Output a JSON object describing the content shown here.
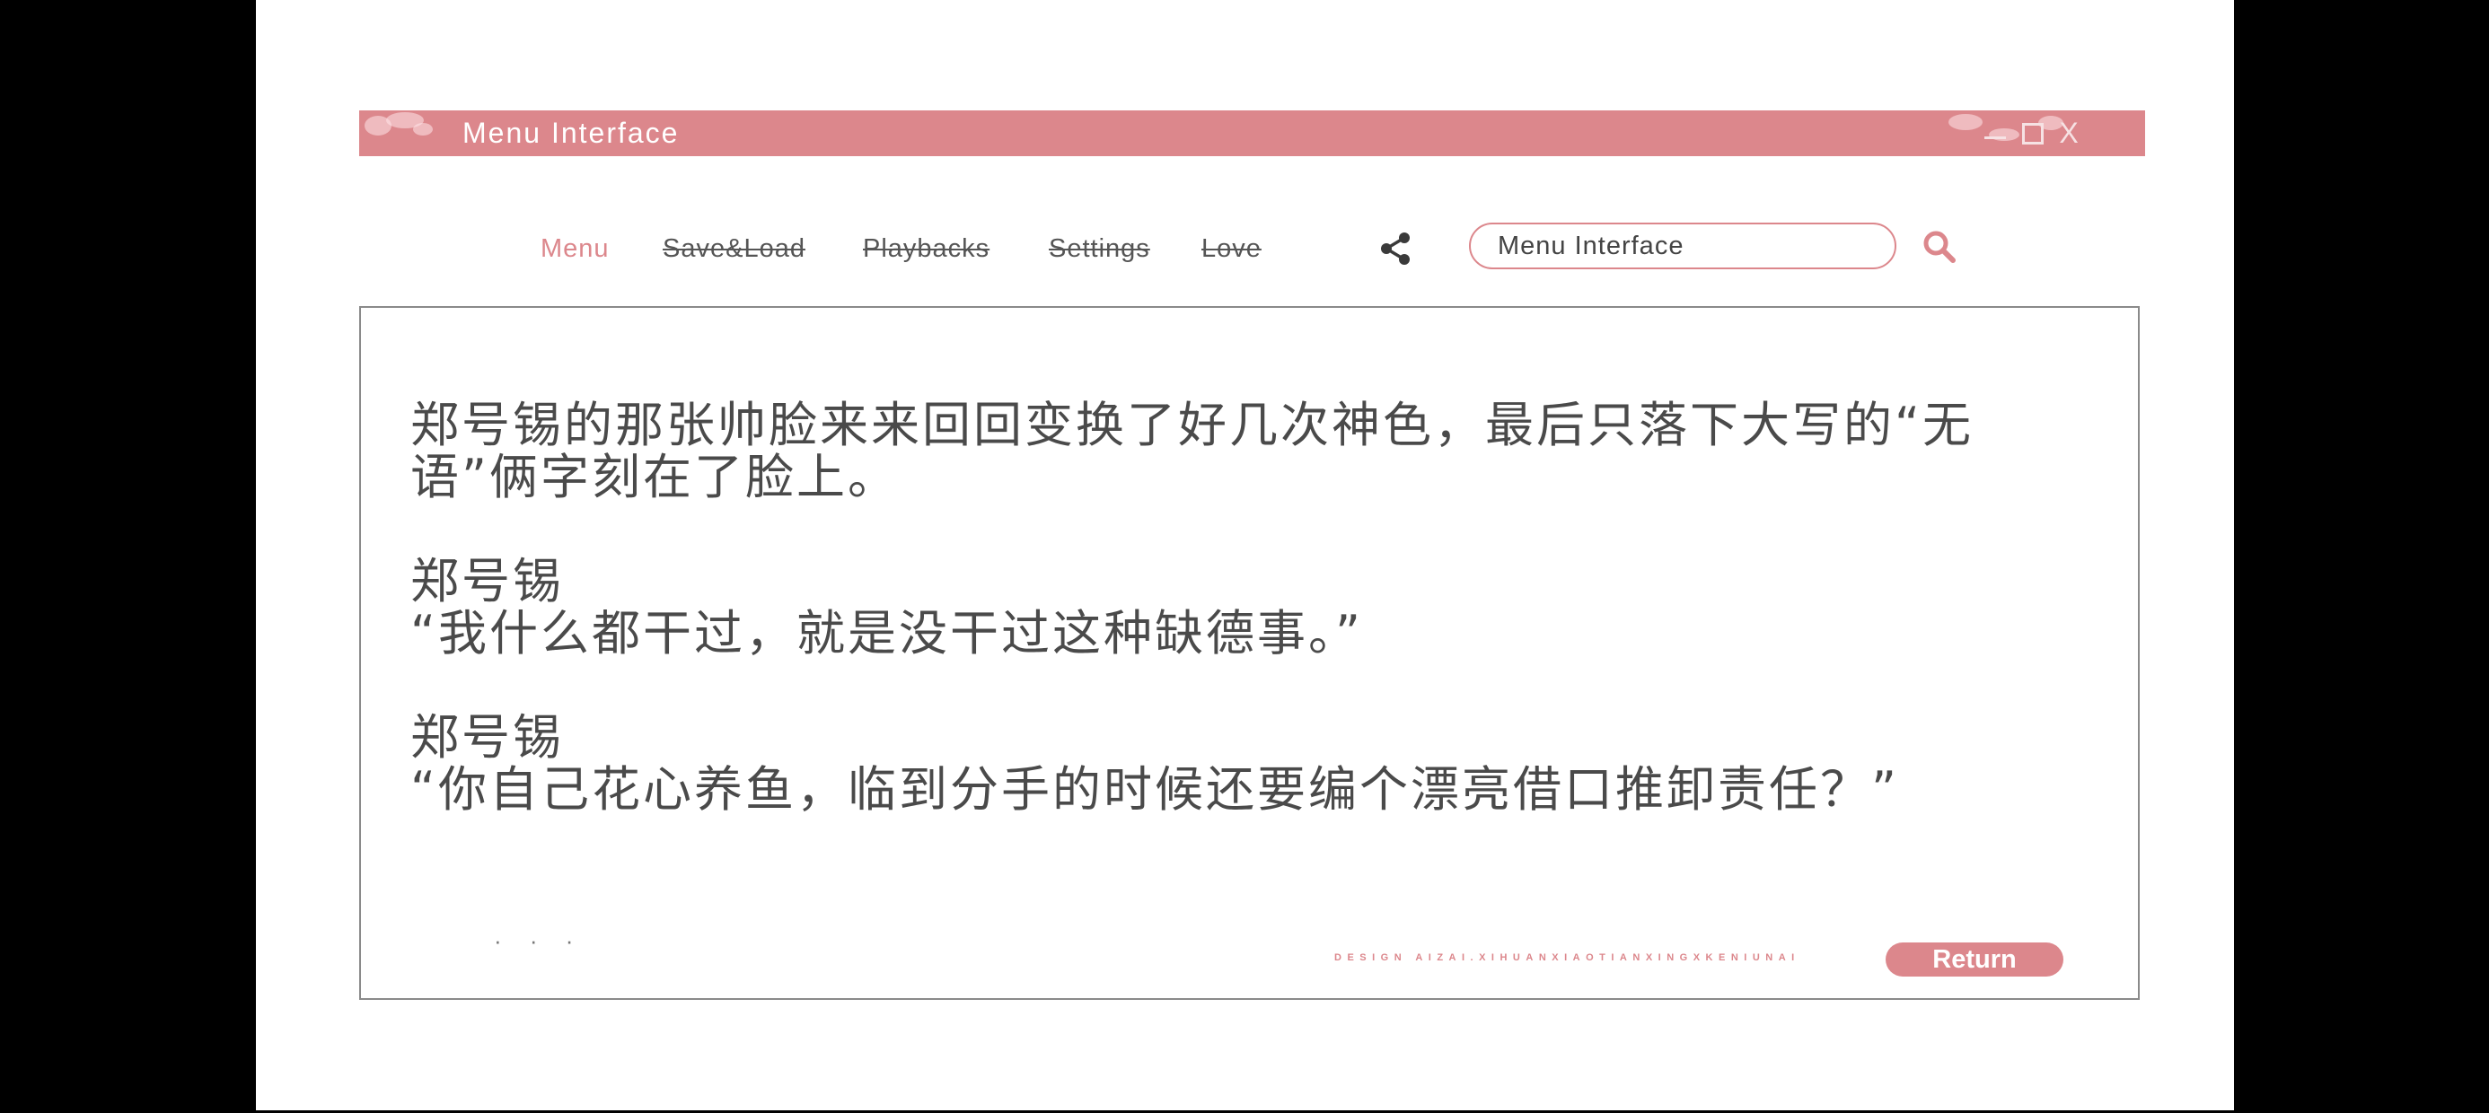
{
  "window": {
    "title": "Menu Interface",
    "controls": {
      "close": "X"
    }
  },
  "nav": {
    "items": [
      {
        "label": "Menu",
        "state": "active"
      },
      {
        "label": "Save&Load",
        "state": "struck"
      },
      {
        "label": "Playbacks",
        "state": "struck"
      },
      {
        "label": "Settings",
        "state": "struck"
      },
      {
        "label": "Love",
        "state": "struck"
      }
    ],
    "share_icon": "share-icon",
    "search": {
      "value": "Menu Interface",
      "icon": "search-icon"
    }
  },
  "dialogue": {
    "narration": "郑号锡的那张帅脸来来回回变换了好几次神色，最后只落下大写的“无语”俩字刻在了脸上。",
    "exchanges": [
      {
        "speaker": "郑号锡",
        "line": "“我什么都干过，就是没干过这种缺德事。”"
      },
      {
        "speaker": "郑号锡",
        "line": "“你自己花心养鱼，临到分手的时候还要编个漂亮借口推卸责任？”"
      }
    ]
  },
  "footer": {
    "ellipsis": "· · ·",
    "design_credit": "DESIGN AIZAI.XIHUANXIAOTIANXINGXKENIUNAI",
    "return_label": "Return"
  },
  "colors": {
    "accent": "#dc878c",
    "text": "#4a4a4a",
    "page_background": "#ffffff",
    "letterbox": "#000000"
  }
}
